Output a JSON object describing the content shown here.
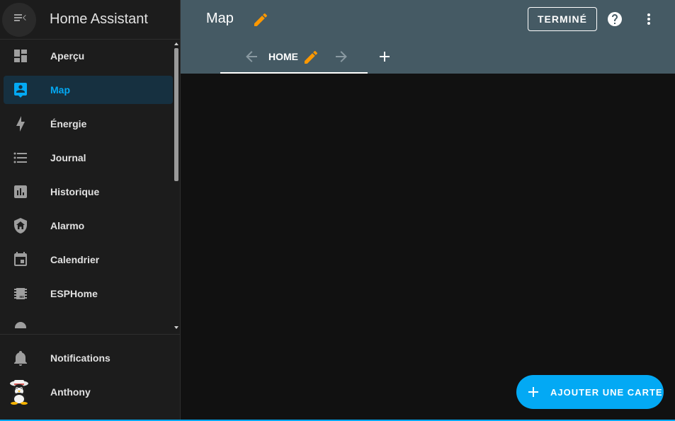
{
  "app": {
    "title": "Home Assistant"
  },
  "sidebar": {
    "items": [
      {
        "label": "Aperçu",
        "icon": "dashboard-icon"
      },
      {
        "label": "Map",
        "icon": "map-account-icon",
        "active": true
      },
      {
        "label": "Énergie",
        "icon": "lightning-bolt-icon"
      },
      {
        "label": "Journal",
        "icon": "format-list-icon"
      },
      {
        "label": "Historique",
        "icon": "chart-box-icon"
      },
      {
        "label": "Alarmo",
        "icon": "shield-home-icon"
      },
      {
        "label": "Calendrier",
        "icon": "calendar-icon"
      },
      {
        "label": "ESPHome",
        "icon": "chip-icon"
      }
    ],
    "notifications_label": "Notifications",
    "user_label": "Anthony"
  },
  "header": {
    "title": "Map",
    "done_label": "TERMINÉ"
  },
  "tabs": [
    {
      "label": "HOME"
    }
  ],
  "fab": {
    "label": "AJOUTER UNE CARTE"
  },
  "colors": {
    "accent": "#03a9f4",
    "edit_pencil": "#ff9800",
    "header_bg": "#455a64",
    "sidebar_bg": "#1c1c1c",
    "content_bg": "#111111"
  }
}
